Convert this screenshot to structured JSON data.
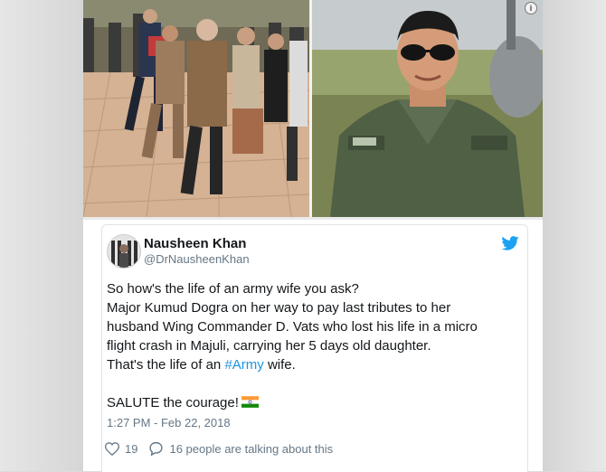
{
  "tweet": {
    "author_name": "Nausheen Khan",
    "author_handle": "@DrNausheenKhan",
    "text_lines": [
      "So how's the life of an army wife you ask?",
      "Major Kumud Dogra on her way to pay last tributes to her",
      "husband Wing Commander D. Vats who lost his life in a micro",
      "flight crash in Majuli, carrying her 5 days old daughter."
    ],
    "last_line_prefix": "That's the life of an ",
    "hashtag": "#Army",
    "last_line_suffix": " wife.",
    "salute_text": "SALUTE the courage!",
    "timestamp": "1:27 PM - Feb 22, 2018",
    "likes": "19",
    "replies_text": "16 people are talking about this"
  },
  "media": {
    "info_badge": "i",
    "left_photo": "group-walking-photo",
    "right_photo": "pilot-portrait-photo"
  },
  "icons": {
    "twitter": "twitter-bird-icon",
    "like": "heart-icon",
    "reply": "speech-bubble-icon",
    "flag": "india-flag-icon"
  },
  "colors": {
    "brand_blue": "#1da1f2",
    "hashtag": "#1b95e0",
    "secondary_text": "#657786"
  }
}
